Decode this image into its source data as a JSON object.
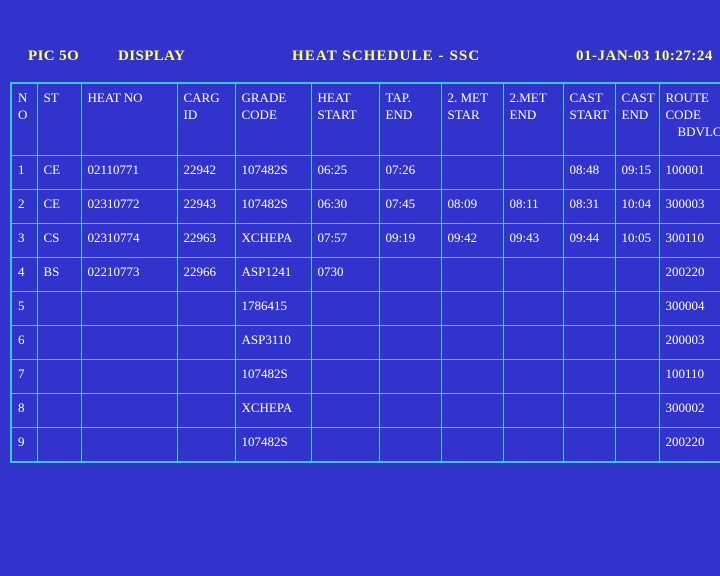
{
  "topbar": {
    "pic": "PIC 5O",
    "display": "DISPLAY",
    "title": "HEAT  SCHEDULE  -  SSC",
    "datetime": "01-JAN-03 10:27:24"
  },
  "colors": {
    "background": "#3232cc",
    "grid_line": "#3cc8d2",
    "header_text": "#ffff66",
    "cell_text": "#ffffff"
  },
  "table": {
    "headers": [
      {
        "line1": "N",
        "line2": "O",
        "line3": ""
      },
      {
        "line1": "ST",
        "line2": "",
        "line3": ""
      },
      {
        "line1": "HEAT NO",
        "line2": "",
        "line3": ""
      },
      {
        "line1": "CARG",
        "line2": "ID",
        "line3": ""
      },
      {
        "line1": "GRADE",
        "line2": "CODE",
        "line3": ""
      },
      {
        "line1": "HEAT",
        "line2": "START",
        "line3": ""
      },
      {
        "line1": "TAP.",
        "line2": "END",
        "line3": ""
      },
      {
        "line1": "2. MET",
        "line2": "STAR",
        "line3": ""
      },
      {
        "line1": "2.MET",
        "line2": "END",
        "line3": ""
      },
      {
        "line1": "CAST",
        "line2": "START",
        "line3": ""
      },
      {
        "line1": "CAST",
        "line2": "END",
        "line3": ""
      },
      {
        "line1": "ROUTE",
        "line2": "CODE",
        "line3": "BDVLCT"
      }
    ],
    "rows": [
      {
        "no": "1",
        "st": "CE",
        "heat_no": "02110771",
        "carg_id": "22942",
        "grade_code": "107482S",
        "heat_start": "06:25",
        "tap_end": "07:26",
        "met2_start": "",
        "met2_end": "",
        "cast_start": "08:48",
        "cast_end": "09:15",
        "route_code": "100001"
      },
      {
        "no": "2",
        "st": "CE",
        "heat_no": "02310772",
        "carg_id": "22943",
        "grade_code": "107482S",
        "heat_start": "06:30",
        "tap_end": "07:45",
        "met2_start": "08:09",
        "met2_end": "08:11",
        "cast_start": "08:31",
        "cast_end": "10:04",
        "route_code": "300003"
      },
      {
        "no": "3",
        "st": "CS",
        "heat_no": "02310774",
        "carg_id": "22963",
        "grade_code": "XCHEPA",
        "heat_start": "07:57",
        "tap_end": "09:19",
        "met2_start": "09:42",
        "met2_end": "09:43",
        "cast_start": "09:44",
        "cast_end": "10:05",
        "route_code": "300110"
      },
      {
        "no": "4",
        "st": "BS",
        "heat_no": "02210773",
        "carg_id": "22966",
        "grade_code": "ASP1241",
        "heat_start": "0730",
        "tap_end": "",
        "met2_start": "",
        "met2_end": "",
        "cast_start": "",
        "cast_end": "",
        "route_code": "200220"
      },
      {
        "no": "5",
        "st": "",
        "heat_no": "",
        "carg_id": "",
        "grade_code": "1786415",
        "heat_start": "",
        "tap_end": "",
        "met2_start": "",
        "met2_end": "",
        "cast_start": "",
        "cast_end": "",
        "route_code": "300004"
      },
      {
        "no": "6",
        "st": "",
        "heat_no": "",
        "carg_id": "",
        "grade_code": "ASP3110",
        "heat_start": "",
        "tap_end": "",
        "met2_start": "",
        "met2_end": "",
        "cast_start": "",
        "cast_end": "",
        "route_code": "200003"
      },
      {
        "no": "7",
        "st": "",
        "heat_no": "",
        "carg_id": "",
        "grade_code": "107482S",
        "heat_start": "",
        "tap_end": "",
        "met2_start": "",
        "met2_end": "",
        "cast_start": "",
        "cast_end": "",
        "route_code": "100110"
      },
      {
        "no": "8",
        "st": "",
        "heat_no": "",
        "carg_id": "",
        "grade_code": "XCHEPA",
        "heat_start": "",
        "tap_end": "",
        "met2_start": "",
        "met2_end": "",
        "cast_start": "",
        "cast_end": "",
        "route_code": "300002"
      },
      {
        "no": "9",
        "st": "",
        "heat_no": "",
        "carg_id": "",
        "grade_code": "107482S",
        "heat_start": "",
        "tap_end": "",
        "met2_start": "",
        "met2_end": "",
        "cast_start": "",
        "cast_end": "",
        "route_code": "200220"
      }
    ]
  }
}
